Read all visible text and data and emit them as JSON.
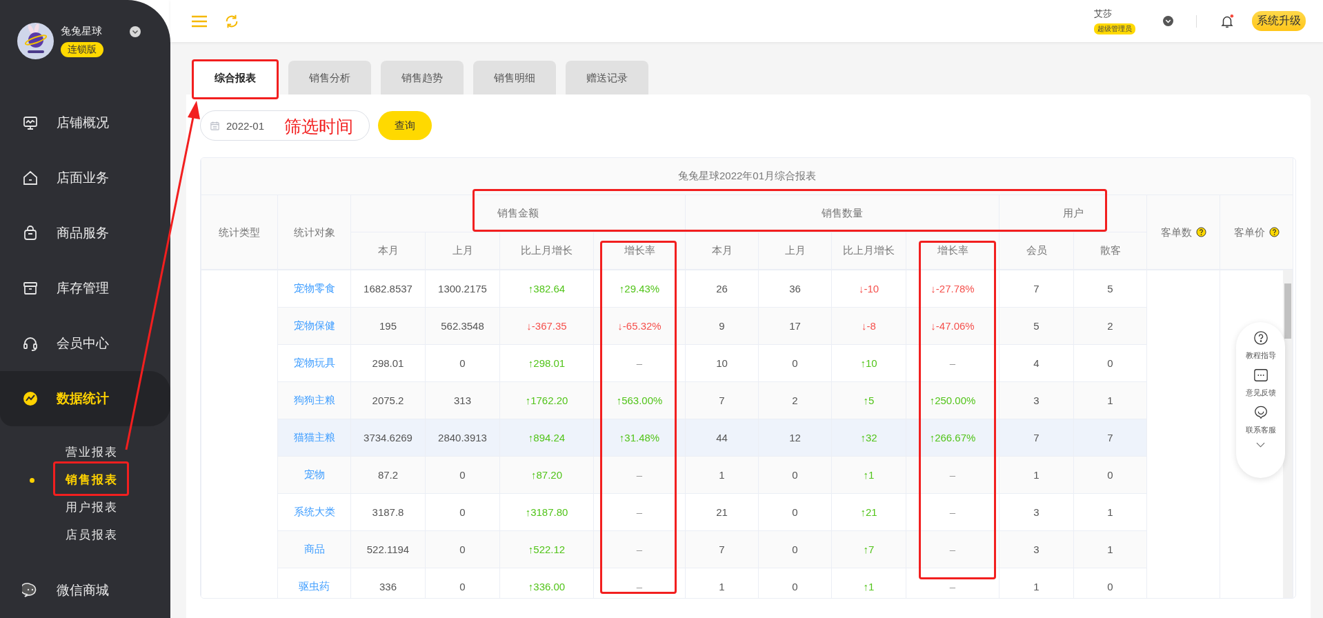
{
  "sidebar": {
    "store_name": "兔兔星球",
    "edition": "连锁版",
    "items": [
      {
        "label": "店铺概况",
        "kind": "monitor",
        "selected": false
      },
      {
        "label": "店面业务",
        "kind": "house",
        "selected": false
      },
      {
        "label": "商品服务",
        "kind": "bag",
        "selected": false
      },
      {
        "label": "库存管理",
        "kind": "box",
        "selected": false
      },
      {
        "label": "会员中心",
        "kind": "headset",
        "selected": false
      },
      {
        "label": "数据统计",
        "kind": "chart",
        "selected": true,
        "expanded": true,
        "children": [
          {
            "label": "营业报表",
            "selected": false
          },
          {
            "label": "销售报表",
            "selected": true
          },
          {
            "label": "用户报表",
            "selected": false
          },
          {
            "label": "店员报表",
            "selected": false
          }
        ]
      },
      {
        "label": "微信商城",
        "kind": "chat",
        "selected": false
      }
    ]
  },
  "header": {
    "user_name": "艾莎",
    "role": "超级管理员",
    "notification_dot": true,
    "upgrade_button": "系统升级"
  },
  "tabs": [
    {
      "label": "综合报表",
      "selected": true
    },
    {
      "label": "销售分析",
      "selected": false
    },
    {
      "label": "销售趋势",
      "selected": false
    },
    {
      "label": "销售明细",
      "selected": false
    },
    {
      "label": "赠送记录",
      "selected": false
    }
  ],
  "filter": {
    "date": "2022-01",
    "query_button": "查询"
  },
  "annotation": {
    "note": "筛选时间"
  },
  "table": {
    "title": "兔兔星球2022年01月综合报表",
    "header": [
      {
        "label": "统计类型"
      },
      {
        "label": "统计对象"
      },
      {
        "label": "销售金额",
        "children": [
          "本月",
          "上月",
          "比上月增长",
          "增长率"
        ]
      },
      {
        "label": "销售数量",
        "children": [
          "本月",
          "上月",
          "比上月增长",
          "增长率"
        ]
      },
      {
        "label": "用户",
        "children": [
          "会员",
          "散客"
        ]
      },
      {
        "label": "客单数",
        "help": true
      },
      {
        "label": "客单价",
        "help": true
      }
    ],
    "rows": [
      {
        "name": "宠物零食",
        "hovered": false,
        "cells": [
          {
            "text": "1682.8537",
            "kind": "plain"
          },
          {
            "text": "1300.2175",
            "kind": "plain"
          },
          {
            "text": "↑382.64",
            "kind": "up"
          },
          {
            "text": "↑29.43%",
            "kind": "up"
          },
          {
            "text": "26",
            "kind": "plain"
          },
          {
            "text": "36",
            "kind": "plain"
          },
          {
            "text": "↓-10",
            "kind": "down"
          },
          {
            "text": "↓-27.78%",
            "kind": "down"
          },
          {
            "text": "7",
            "kind": "plain"
          },
          {
            "text": "5",
            "kind": "plain"
          }
        ]
      },
      {
        "name": "宠物保健",
        "hovered": false,
        "cells": [
          {
            "text": "195",
            "kind": "plain"
          },
          {
            "text": "562.3548",
            "kind": "plain"
          },
          {
            "text": "↓-367.35",
            "kind": "down"
          },
          {
            "text": "↓-65.32%",
            "kind": "down"
          },
          {
            "text": "9",
            "kind": "plain"
          },
          {
            "text": "17",
            "kind": "plain"
          },
          {
            "text": "↓-8",
            "kind": "down"
          },
          {
            "text": "↓-47.06%",
            "kind": "down"
          },
          {
            "text": "5",
            "kind": "plain"
          },
          {
            "text": "2",
            "kind": "plain"
          }
        ]
      },
      {
        "name": "宠物玩具",
        "hovered": false,
        "cells": [
          {
            "text": "298.01",
            "kind": "plain"
          },
          {
            "text": "0",
            "kind": "plain"
          },
          {
            "text": "↑298.01",
            "kind": "up"
          },
          {
            "text": "–",
            "kind": "none"
          },
          {
            "text": "10",
            "kind": "plain"
          },
          {
            "text": "0",
            "kind": "plain"
          },
          {
            "text": "↑10",
            "kind": "up"
          },
          {
            "text": "–",
            "kind": "none"
          },
          {
            "text": "4",
            "kind": "plain"
          },
          {
            "text": "0",
            "kind": "plain"
          }
        ]
      },
      {
        "name": "狗狗主粮",
        "hovered": false,
        "cells": [
          {
            "text": "2075.2",
            "kind": "plain"
          },
          {
            "text": "313",
            "kind": "plain"
          },
          {
            "text": "↑1762.20",
            "kind": "up"
          },
          {
            "text": "↑563.00%",
            "kind": "up"
          },
          {
            "text": "7",
            "kind": "plain"
          },
          {
            "text": "2",
            "kind": "plain"
          },
          {
            "text": "↑5",
            "kind": "up"
          },
          {
            "text": "↑250.00%",
            "kind": "up"
          },
          {
            "text": "3",
            "kind": "plain"
          },
          {
            "text": "1",
            "kind": "plain"
          }
        ]
      },
      {
        "name": "猫猫主粮",
        "hovered": true,
        "cells": [
          {
            "text": "3734.6269",
            "kind": "plain"
          },
          {
            "text": "2840.3913",
            "kind": "plain"
          },
          {
            "text": "↑894.24",
            "kind": "up"
          },
          {
            "text": "↑31.48%",
            "kind": "up"
          },
          {
            "text": "44",
            "kind": "plain"
          },
          {
            "text": "12",
            "kind": "plain"
          },
          {
            "text": "↑32",
            "kind": "up"
          },
          {
            "text": "↑266.67%",
            "kind": "up"
          },
          {
            "text": "7",
            "kind": "plain"
          },
          {
            "text": "7",
            "kind": "plain"
          }
        ]
      },
      {
        "name": "宠物",
        "hovered": false,
        "cells": [
          {
            "text": "87.2",
            "kind": "plain"
          },
          {
            "text": "0",
            "kind": "plain"
          },
          {
            "text": "↑87.20",
            "kind": "up"
          },
          {
            "text": "–",
            "kind": "none"
          },
          {
            "text": "1",
            "kind": "plain"
          },
          {
            "text": "0",
            "kind": "plain"
          },
          {
            "text": "↑1",
            "kind": "up"
          },
          {
            "text": "–",
            "kind": "none"
          },
          {
            "text": "1",
            "kind": "plain"
          },
          {
            "text": "0",
            "kind": "plain"
          }
        ]
      },
      {
        "name": "系统大类",
        "hovered": false,
        "cells": [
          {
            "text": "3187.8",
            "kind": "plain"
          },
          {
            "text": "0",
            "kind": "plain"
          },
          {
            "text": "↑3187.80",
            "kind": "up"
          },
          {
            "text": "–",
            "kind": "none"
          },
          {
            "text": "21",
            "kind": "plain"
          },
          {
            "text": "0",
            "kind": "plain"
          },
          {
            "text": "↑21",
            "kind": "up"
          },
          {
            "text": "–",
            "kind": "none"
          },
          {
            "text": "3",
            "kind": "plain"
          },
          {
            "text": "1",
            "kind": "plain"
          }
        ]
      },
      {
        "name": "商品",
        "hovered": false,
        "cells": [
          {
            "text": "522.1194",
            "kind": "plain"
          },
          {
            "text": "0",
            "kind": "plain"
          },
          {
            "text": "↑522.12",
            "kind": "up"
          },
          {
            "text": "–",
            "kind": "none"
          },
          {
            "text": "7",
            "kind": "plain"
          },
          {
            "text": "0",
            "kind": "plain"
          },
          {
            "text": "↑7",
            "kind": "up"
          },
          {
            "text": "–",
            "kind": "none"
          },
          {
            "text": "3",
            "kind": "plain"
          },
          {
            "text": "1",
            "kind": "plain"
          }
        ]
      },
      {
        "name": "驱虫药",
        "hovered": false,
        "cells": [
          {
            "text": "336",
            "kind": "plain"
          },
          {
            "text": "0",
            "kind": "plain"
          },
          {
            "text": "↑336.00",
            "kind": "up"
          },
          {
            "text": "–",
            "kind": "none"
          },
          {
            "text": "1",
            "kind": "plain"
          },
          {
            "text": "0",
            "kind": "plain"
          },
          {
            "text": "↑1",
            "kind": "up"
          },
          {
            "text": "–",
            "kind": "none"
          },
          {
            "text": "1",
            "kind": "plain"
          },
          {
            "text": "0",
            "kind": "plain"
          }
        ]
      }
    ]
  },
  "help_panel": [
    {
      "label": "教程指导",
      "kind": "question"
    },
    {
      "label": "意见反馈",
      "kind": "dots"
    },
    {
      "label": "联系客服",
      "kind": "smile"
    }
  ]
}
